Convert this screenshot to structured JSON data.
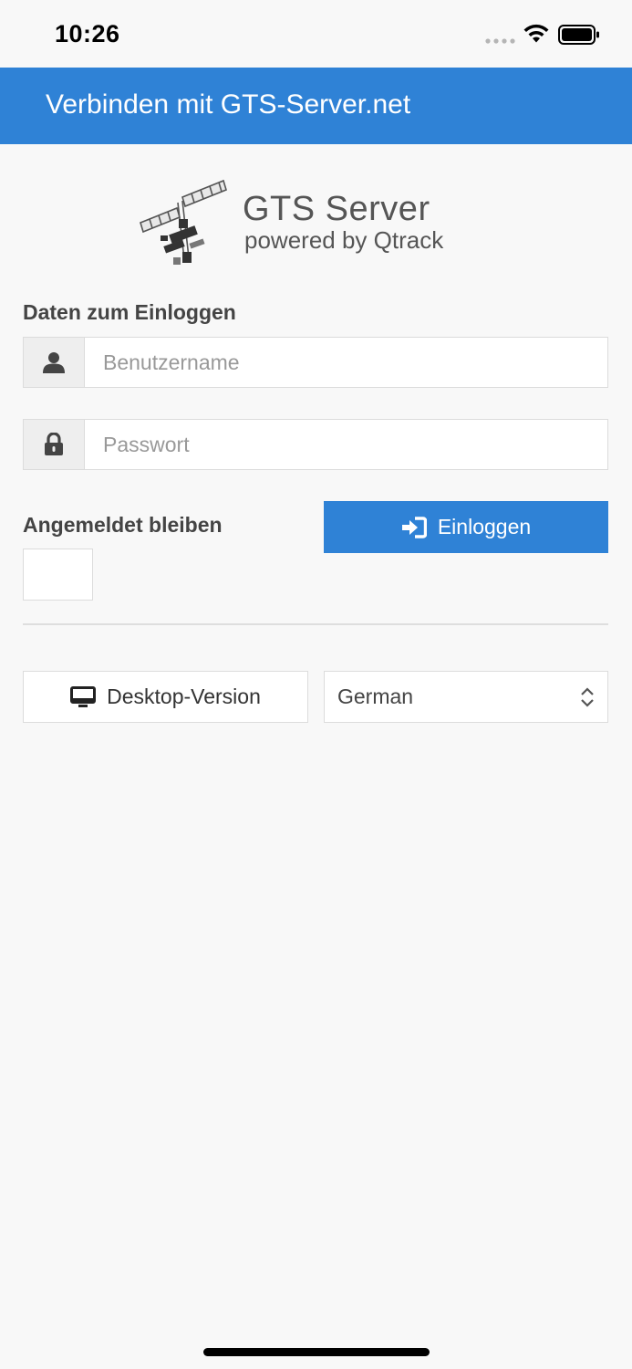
{
  "status_bar": {
    "time": "10:26"
  },
  "header": {
    "title": "Verbinden mit GTS-Server.net"
  },
  "logo": {
    "title": "GTS Server",
    "subtitle": "powered by Qtrack"
  },
  "login_form": {
    "section_label": "Daten zum Einloggen",
    "username_placeholder": "Benutzername",
    "username_value": "",
    "password_placeholder": "Passwort",
    "password_value": "",
    "remember_label": "Angemeldet bleiben",
    "remember_checked": false,
    "login_button_label": "Einloggen"
  },
  "footer_actions": {
    "desktop_button_label": "Desktop-Version",
    "language_selected": "German"
  },
  "colors": {
    "primary": "#2f82d6",
    "background": "#f8f8f8",
    "border": "#dcdcdc"
  },
  "icons": {
    "username": "user-icon",
    "password": "lock-icon",
    "login": "sign-in-icon",
    "desktop": "desktop-icon",
    "select": "chevron-up-down-icon"
  }
}
